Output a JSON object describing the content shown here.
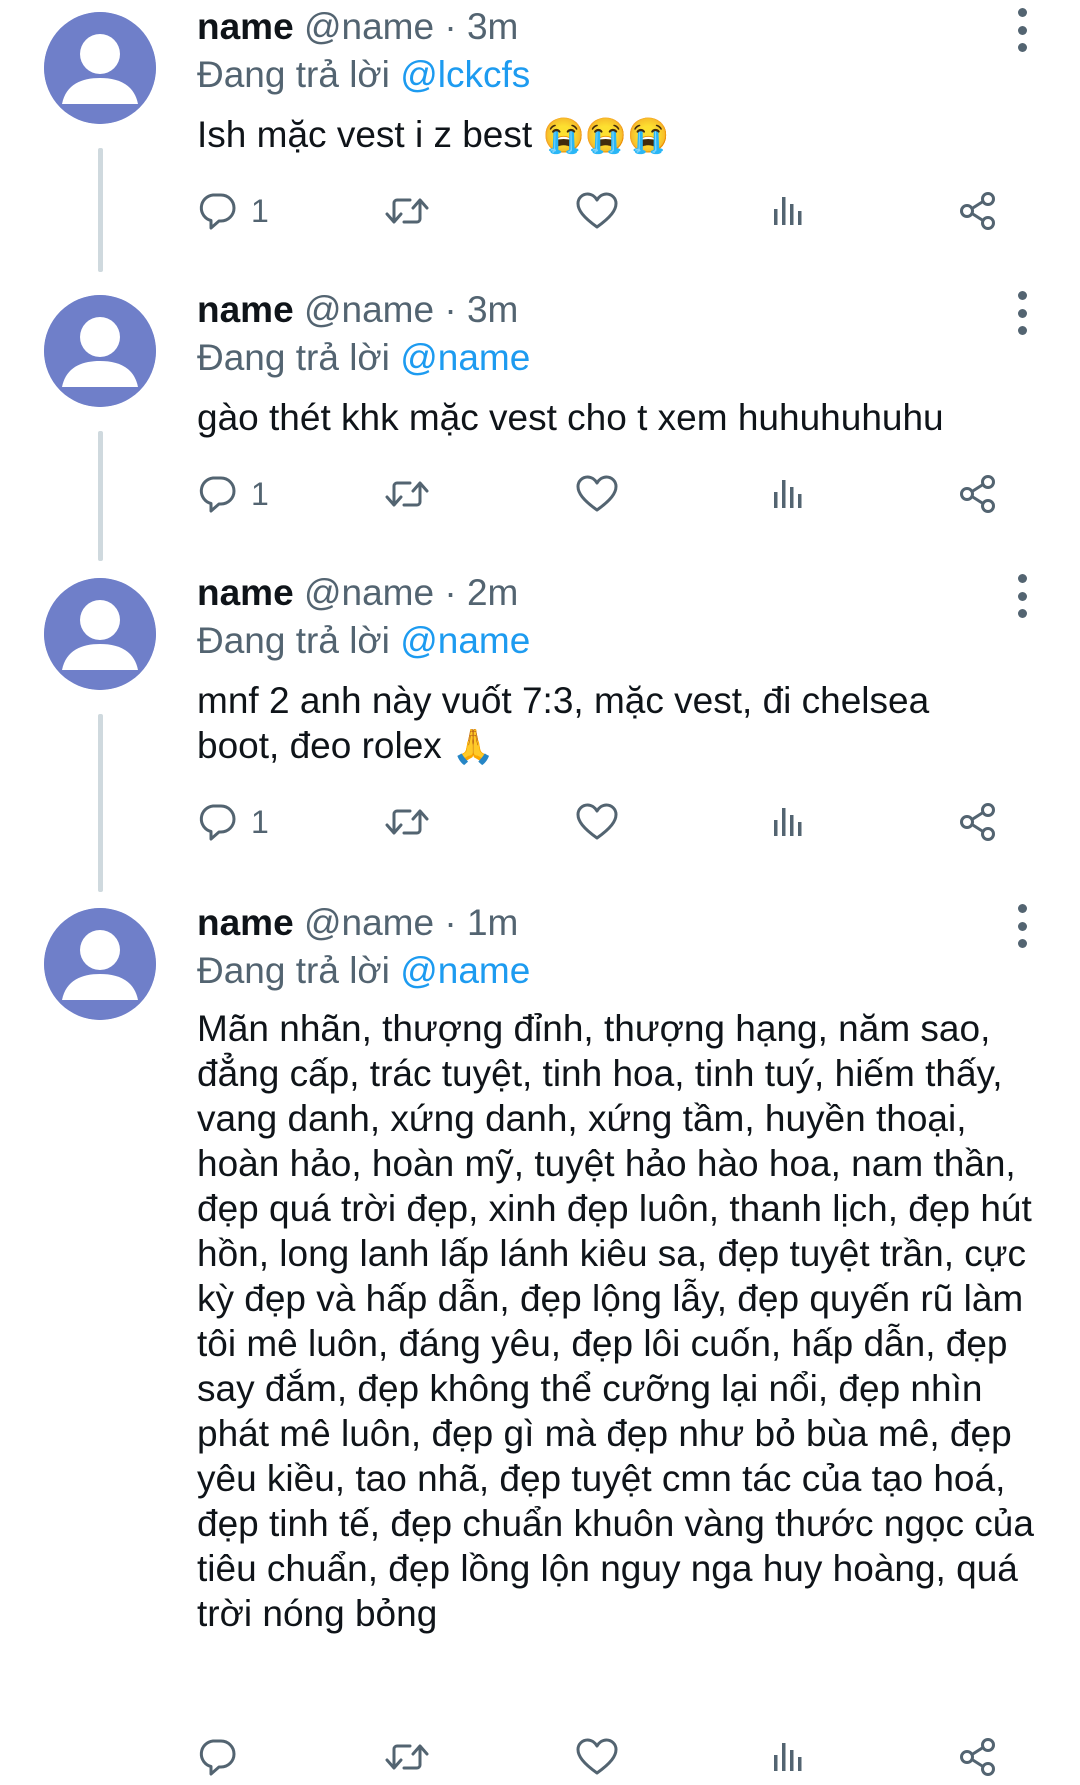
{
  "replying_prefix": "Đang trả lời",
  "tweets": [
    {
      "name": "name",
      "handle": "@name",
      "separator": "·",
      "time": "3m",
      "replying_to": "@lckcfs",
      "text": "Ish mặc vest i z best",
      "emoji": "😭😭😭",
      "reply_count": "1"
    },
    {
      "name": "name",
      "handle": "@name",
      "separator": "·",
      "time": "3m",
      "replying_to": "@name",
      "text": "gào thét khk mặc vest cho t xem huhuhuhuhu",
      "emoji": "",
      "reply_count": "1"
    },
    {
      "name": "name",
      "handle": "@name",
      "separator": "·",
      "time": "2m",
      "replying_to": "@name",
      "text": "mnf 2 anh này vuốt 7:3, mặc vest, đi chelsea boot, đeo rolex",
      "emoji": "🙏",
      "reply_count": "1"
    },
    {
      "name": "name",
      "handle": "@name",
      "separator": "·",
      "time": "1m",
      "replying_to": "@name",
      "text": "Mãn nhãn, thượng đỉnh, thượng hạng, năm sao, đẳng cấp, trác tuyệt, tinh hoa, tinh tuý, hiếm thấy, vang danh, xứng danh, xứng tầm, huyền thoại, hoàn hảo, hoàn mỹ, tuyệt hảo hào hoa, nam thần, đẹp quá trời đẹp, xinh đẹp luôn, thanh lịch, đẹp hút hồn, long lanh lấp lánh kiêu sa, đẹp tuyệt trần, cực kỳ đẹp và hấp dẫn, đẹp lộng lẫy, đẹp quyến rũ làm tôi mê luôn, đáng yêu, đẹp lôi cuốn, hấp dẫn, đẹp say đắm, đẹp không thể cưỡng lại nổi, đẹp nhìn phát mê luôn, đẹp gì mà đẹp như bỏ bùa mê, đẹp yêu kiều, tao nhã, đẹp tuyệt cmn tác của tạo hoá, đẹp tinh tế, đẹp chuẩn khuôn vàng thước ngọc của tiêu chuẩn, đẹp lồng lộn nguy nga huy hoàng, quá trời nóng bỏng",
      "emoji": "",
      "reply_count": ""
    }
  ],
  "colors": {
    "text": "#0f1419",
    "secondary": "#536471",
    "link": "#1d9bf0",
    "thread_line": "#cfd9de",
    "avatar_bg": "#6f7fc9"
  },
  "icons": [
    "reply-icon",
    "retweet-icon",
    "like-icon",
    "views-icon",
    "share-icon",
    "more-options-icon"
  ]
}
